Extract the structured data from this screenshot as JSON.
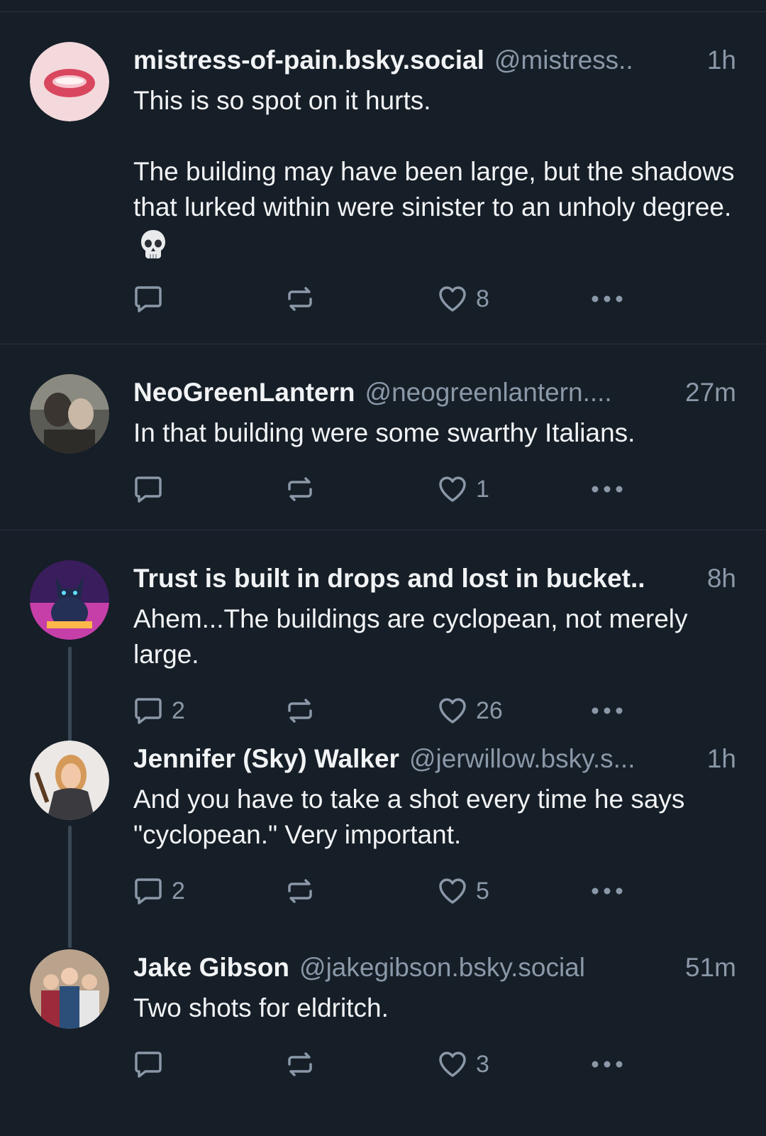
{
  "posts": [
    {
      "name": "mistress-of-pain.bsky.social",
      "handle": "@mistress..",
      "time": "1h",
      "text": "This is so spot on it hurts.\n\nThe building may have been large, but the shadows that lurked within were sinister to an unholy degree. ",
      "emoji": "skull-emoji",
      "reply_count": "",
      "like_count": "8"
    },
    {
      "name": "NeoGreenLantern",
      "handle": "@neogreenlantern....",
      "time": "27m",
      "text": "In that building were some swarthy Italians.",
      "reply_count": "",
      "like_count": "1"
    },
    {
      "name": "Trust is built in drops and lost in bucket..",
      "handle": "",
      "time": "8h",
      "text": "Ahem...The buildings are cyclopean, not merely large.",
      "reply_count": "2",
      "like_count": "26"
    },
    {
      "name": "Jennifer (Sky) Walker",
      "handle": "@jerwillow.bsky.s...",
      "time": "1h",
      "text": "And you have to take a shot every time he says \"cyclopean.\" Very important.",
      "reply_count": "2",
      "like_count": "5"
    },
    {
      "name": "Jake Gibson",
      "handle": "@jakegibson.bsky.social",
      "time": "51m",
      "text": "Two shots for eldritch.",
      "reply_count": "",
      "like_count": "3"
    }
  ],
  "icons": {
    "reply": "reply-icon",
    "repost": "repost-icon",
    "like": "heart-icon",
    "more": "more-icon"
  },
  "colors": {
    "background": "#161e27",
    "text": "#f1f3f5",
    "muted": "#8a98a8",
    "divider": "#2a3440",
    "thread_line": "#3a4756"
  }
}
